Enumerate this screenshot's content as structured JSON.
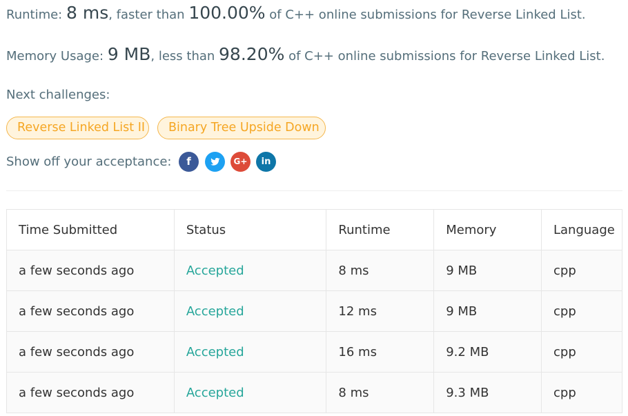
{
  "summary": {
    "runtime": {
      "label": "Runtime:",
      "value": "8 ms",
      "comparison": ", faster than",
      "percent": "100.00%",
      "suffix": "of C++ online submissions for Reverse Linked List."
    },
    "memory": {
      "label": "Memory Usage:",
      "value": "9 MB",
      "comparison": ", less than",
      "percent": "98.20%",
      "suffix": "of C++ online submissions for Reverse Linked List."
    }
  },
  "next_challenges": {
    "label": "Next challenges:",
    "items": [
      "Reverse Linked List II",
      "Binary Tree Upside Down"
    ]
  },
  "share": {
    "label": "Show off your acceptance:",
    "icons": [
      {
        "name": "facebook-icon",
        "glyph": "f",
        "color": "#3b5998"
      },
      {
        "name": "twitter-icon",
        "glyph": "t",
        "color": "#1da1f2"
      },
      {
        "name": "google-plus-icon",
        "glyph": "G+",
        "color": "#dd4b39"
      },
      {
        "name": "linkedin-icon",
        "glyph": "in",
        "color": "#0e76a8"
      }
    ]
  },
  "table": {
    "headers": [
      "Time Submitted",
      "Status",
      "Runtime",
      "Memory",
      "Language"
    ],
    "rows": [
      [
        "a few seconds ago",
        "Accepted",
        "8 ms",
        "9 MB",
        "cpp"
      ],
      [
        "a few seconds ago",
        "Accepted",
        "12 ms",
        "9 MB",
        "cpp"
      ],
      [
        "a few seconds ago",
        "Accepted",
        "16 ms",
        "9.2 MB",
        "cpp"
      ],
      [
        "a few seconds ago",
        "Accepted",
        "8 ms",
        "9.3 MB",
        "cpp"
      ]
    ]
  },
  "colors": {
    "accepted": "#26a69a",
    "chip_text": "#f5a623",
    "chip_bg": "#fff4dd",
    "chip_border": "#f5b74d"
  }
}
